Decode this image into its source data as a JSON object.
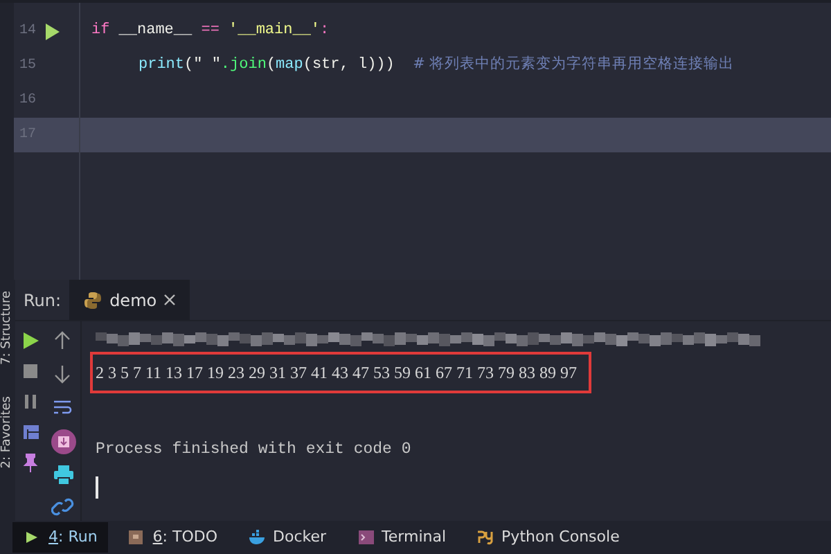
{
  "editor": {
    "lines": [
      {
        "number": "14",
        "run_marker": true,
        "current": false,
        "tokens": [
          {
            "kind": "keyword",
            "text": "if"
          },
          {
            "kind": "plain",
            "text": " __name__ "
          },
          {
            "kind": "keyword",
            "text": "=="
          },
          {
            "kind": "string",
            "text": " '__main__'"
          },
          {
            "kind": "keyword",
            "text": ":"
          }
        ]
      },
      {
        "number": "15",
        "run_marker": false,
        "current": false,
        "indented": true,
        "tokens": [
          {
            "kind": "builtin",
            "text": "print"
          },
          {
            "kind": "plain",
            "text": "(\" \""
          },
          {
            "kind": "method",
            "text": ".join"
          },
          {
            "kind": "plain",
            "text": "("
          },
          {
            "kind": "builtin",
            "text": "map"
          },
          {
            "kind": "plain",
            "text": "(str, l)))  "
          },
          {
            "kind": "comment",
            "text": "# 将列表中的元素变为字符串再用空格连接输出"
          }
        ]
      },
      {
        "number": "16",
        "run_marker": false,
        "current": false
      },
      {
        "number": "17",
        "run_marker": false,
        "current": true
      }
    ]
  },
  "side_tools": [
    "7: Structure",
    "2: Favorites"
  ],
  "run_panel": {
    "label": "Run:",
    "tab": {
      "title": "demo",
      "selected": true
    },
    "console": [
      {
        "kind": "blurred"
      },
      {
        "kind": "output",
        "text": "2 3 5 7 11 13 17 19 23 29 31 37 41 43 47 53 59 61 67 71 73 79 83 89 97",
        "highlighted": true
      },
      {
        "kind": "blank"
      },
      {
        "kind": "output",
        "text": "Process finished with exit code 0",
        "highlighted": false
      },
      {
        "kind": "cursor"
      }
    ]
  },
  "bottom_tabs": [
    {
      "kind": "run",
      "mnemonic": "4",
      "label": ": Run",
      "selected": true
    },
    {
      "kind": "todo",
      "mnemonic": "6",
      "label": ": TODO",
      "selected": false
    },
    {
      "kind": "docker",
      "label": "Docker",
      "selected": false
    },
    {
      "kind": "terminal",
      "label": "Terminal",
      "selected": false
    },
    {
      "kind": "python",
      "label": "Python Console",
      "selected": false
    }
  ]
}
